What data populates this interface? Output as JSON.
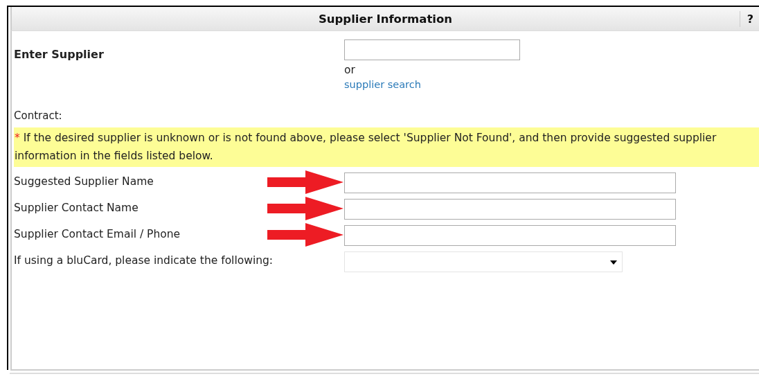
{
  "panel": {
    "title": "Supplier Information",
    "help": "?"
  },
  "enter_supplier": {
    "label": "Enter Supplier",
    "or": "or",
    "link": "supplier search"
  },
  "contract": {
    "label": "Contract:"
  },
  "notice": {
    "mark": "*",
    "text": "If the desired supplier is unknown or is not found above, please select 'Supplier Not Found', and then provide suggested supplier information in the fields listed below."
  },
  "fields": [
    {
      "kind": "text",
      "label": "Suggested Supplier Name",
      "arrow": true
    },
    {
      "kind": "text",
      "label": "Supplier Contact Name",
      "arrow": true
    },
    {
      "kind": "text",
      "label": "Supplier Contact Email / Phone",
      "arrow": true
    },
    {
      "kind": "select",
      "label": "If using a bluCard, please indicate the following:",
      "arrow": false
    }
  ]
}
